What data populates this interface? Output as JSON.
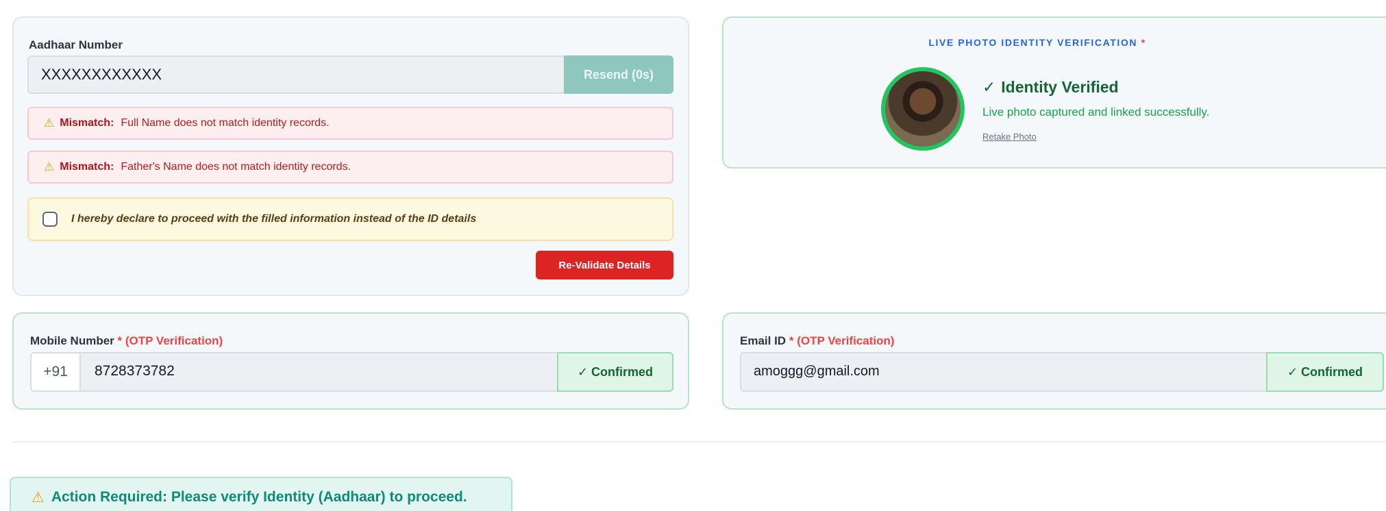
{
  "aadhaar": {
    "label": "Aadhaar Number",
    "value": "XXXXXXXXXXXX",
    "resend_label": "Resend (0s)",
    "mismatch_prefix": "Mismatch:",
    "mismatches": [
      "Full Name does not match identity records.",
      "Father's Name does not match identity records."
    ],
    "declaration": "I hereby declare to proceed with the filled information instead of the ID details",
    "declaration_checked": false,
    "revalidate_label": "Re-Validate Details"
  },
  "live_photo": {
    "title": "LIVE PHOTO IDENTITY VERIFICATION",
    "required_mark": "*",
    "status_icon": "✓",
    "status_title": "Identity Verified",
    "status_sub": "Live photo captured and linked successfully.",
    "retake_label": "Retake Photo"
  },
  "mobile": {
    "label": "Mobile Number",
    "required_mark": "*",
    "otp_note": "(OTP Verification)",
    "prefix": "+91",
    "value": "8728373782",
    "confirm_label": "✓ Confirmed"
  },
  "email": {
    "label": "Email ID",
    "required_mark": "*",
    "otp_note": "(OTP Verification)",
    "value": "amoggg@gmail.com",
    "confirm_label": "✓ Confirmed"
  },
  "action_banner": {
    "icon": "⚠",
    "text": "Action Required: Please verify Identity (Aadhaar) to proceed."
  },
  "colors": {
    "accent_blue": "#2563eb",
    "success_green": "#16a34a",
    "error_red": "#dc2424",
    "teal": "#0f8a78"
  }
}
